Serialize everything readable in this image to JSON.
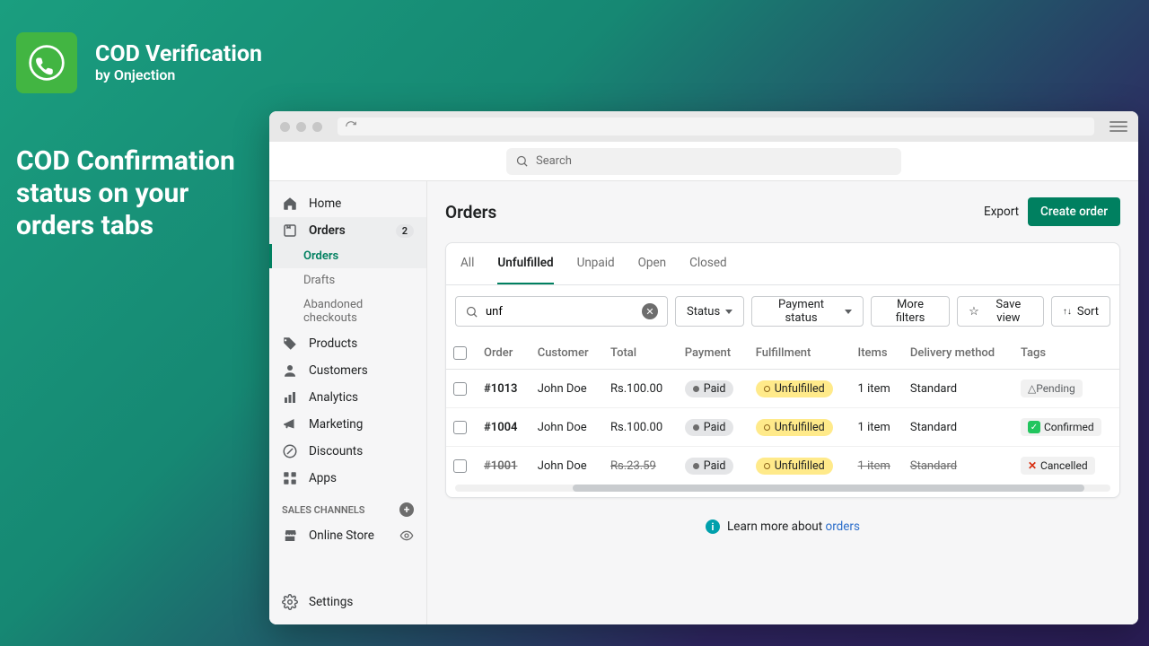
{
  "promo": {
    "app_name": "COD Verification",
    "by": "by Onjection",
    "headline": "COD Confirmation status on your orders tabs"
  },
  "topbar": {
    "search_placeholder": "Search"
  },
  "sidebar": {
    "home": "Home",
    "orders": "Orders",
    "orders_badge": "2",
    "sub_orders": "Orders",
    "sub_drafts": "Drafts",
    "sub_abandoned": "Abandoned checkouts",
    "products": "Products",
    "customers": "Customers",
    "analytics": "Analytics",
    "marketing": "Marketing",
    "discounts": "Discounts",
    "apps": "Apps",
    "sales_channels": "SALES CHANNELS",
    "online_store": "Online Store",
    "settings": "Settings"
  },
  "page": {
    "title": "Orders",
    "export": "Export",
    "create": "Create order"
  },
  "tabs": {
    "all": "All",
    "unfulfilled": "Unfulfilled",
    "unpaid": "Unpaid",
    "open": "Open",
    "closed": "Closed"
  },
  "filters": {
    "query": "unf",
    "status": "Status",
    "payment_status": "Payment status",
    "more": "More filters",
    "save_view": "Save view",
    "sort": "Sort"
  },
  "table": {
    "cols": {
      "order": "Order",
      "customer": "Customer",
      "total": "Total",
      "payment": "Payment",
      "fulfillment": "Fulfillment",
      "items": "Items",
      "delivery": "Delivery method",
      "tags": "Tags"
    },
    "rows": [
      {
        "order": "#1013",
        "customer": "John Doe",
        "total": "Rs.100.00",
        "payment": "Paid",
        "fulfillment": "Unfulfilled",
        "items": "1 item",
        "delivery": "Standard",
        "tag": "Pending",
        "tag_kind": "pending",
        "strike": false
      },
      {
        "order": "#1004",
        "customer": "John Doe",
        "total": "Rs.100.00",
        "payment": "Paid",
        "fulfillment": "Unfulfilled",
        "items": "1 item",
        "delivery": "Standard",
        "tag": "Confirmed",
        "tag_kind": "confirmed",
        "strike": false
      },
      {
        "order": "#1001",
        "customer": "John Doe",
        "total": "Rs.23.59",
        "payment": "Paid",
        "fulfillment": "Unfulfilled",
        "items": "1 item",
        "delivery": "Standard",
        "tag": "Cancelled",
        "tag_kind": "cancelled",
        "strike": true
      }
    ]
  },
  "learn": {
    "text": "Learn more about ",
    "link": "orders"
  }
}
